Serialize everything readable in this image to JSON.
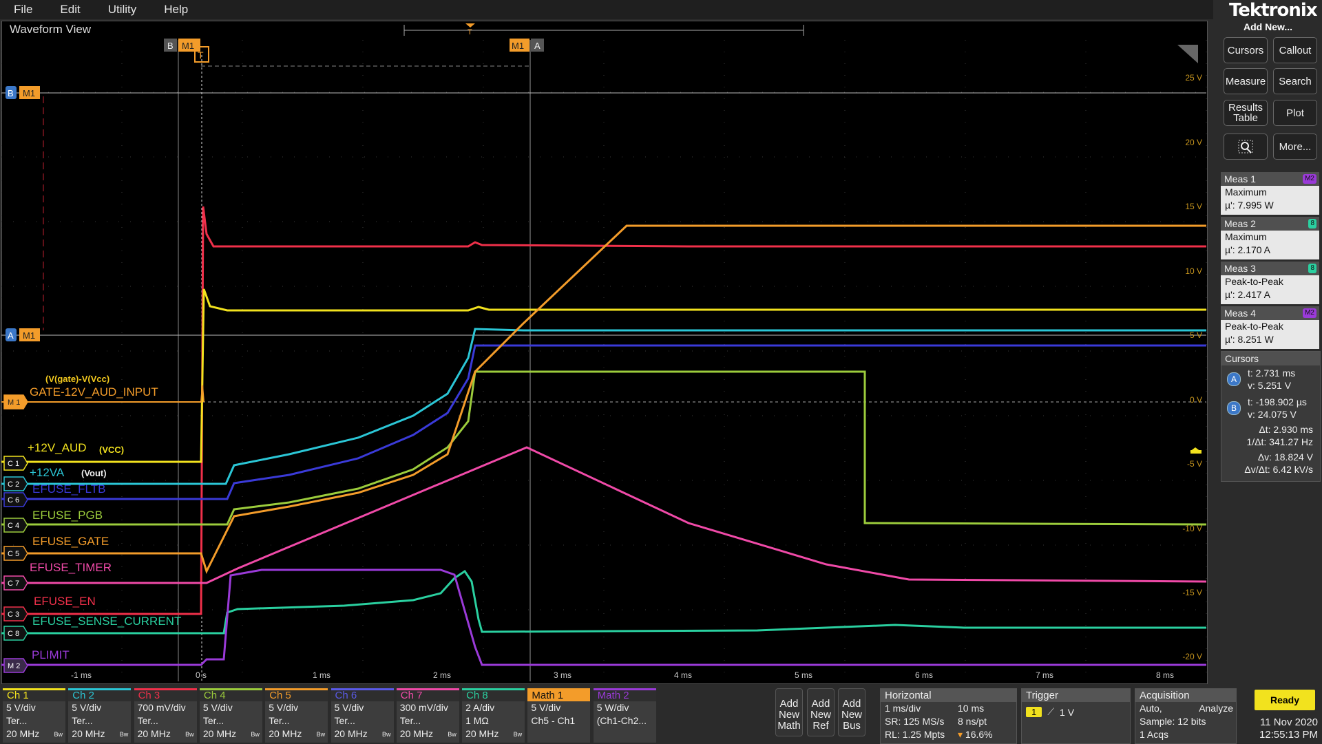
{
  "menu": [
    "File",
    "Edit",
    "Utility",
    "Help"
  ],
  "waveform_view": {
    "title": "Waveform View",
    "marker_b": "B",
    "marker_a": "A",
    "m1_tag": "M1",
    "y_ticks": [
      "25 V",
      "20 V",
      "15 V",
      "10 V",
      "5 V",
      "0 V",
      "-5 V",
      "-10 V",
      "-15 V",
      "-20 V"
    ],
    "x_ticks": [
      "-1 ms",
      "0 s",
      "1 ms",
      "2 ms",
      "3 ms",
      "4 ms",
      "5 ms",
      "6 ms",
      "7 ms",
      "8 ms"
    ],
    "annotations": {
      "gate_formula": "(V(gate)-V(Vcc)",
      "vcc": "(VCC)",
      "vout": "(Vout)"
    },
    "channel_labels": [
      {
        "tag": "M 1",
        "label": "GATE-12V_AUD_INPUT",
        "color": "#f39c2a"
      },
      {
        "tag": "C 1",
        "label": "+12V_AUD",
        "color": "#f2e21e"
      },
      {
        "tag": "C 2",
        "label": "+12VA",
        "color": "#2bc6d6"
      },
      {
        "tag": "C 6",
        "label": "EFUSE_FLTB",
        "color": "#3a3ad8"
      },
      {
        "tag": "C 4",
        "label": "EFUSE_PGB",
        "color": "#9ccc3c"
      },
      {
        "tag": "C 5",
        "label": "EFUSE_GATE",
        "color": "#f39c2a"
      },
      {
        "tag": "C 7",
        "label": "EFUSE_TIMER",
        "color": "#f04aa8"
      },
      {
        "tag": "C 3",
        "label": "EFUSE_EN",
        "color": "#f0304a"
      },
      {
        "tag": "C 8",
        "label": "EFUSE_SENSE_CURRENT",
        "color": "#2ad0a0"
      },
      {
        "tag": "M 2",
        "label": "PLIMIT",
        "color": "#9a3ad8"
      }
    ]
  },
  "right_panel": {
    "logo": "Tektronix",
    "add_new": "Add New...",
    "buttons": [
      "Cursors",
      "Callout",
      "Measure",
      "Search",
      "Results Table",
      "Plot",
      "More..."
    ],
    "measurements": [
      {
        "name": "Meas 1",
        "badge": "M2",
        "badge_color": "#9a3ad8",
        "type": "Maximum",
        "value": "µ': 7.995 W"
      },
      {
        "name": "Meas 2",
        "badge": "8",
        "badge_color": "#2ad0a0",
        "type": "Maximum",
        "value": "µ': 2.170 A"
      },
      {
        "name": "Meas 3",
        "badge": "8",
        "badge_color": "#2ad0a0",
        "type": "Peak-to-Peak",
        "value": "µ': 2.417 A"
      },
      {
        "name": "Meas 4",
        "badge": "M2",
        "badge_color": "#9a3ad8",
        "type": "Peak-to-Peak",
        "value": "µ': 8.251 W"
      }
    ],
    "cursors": {
      "title": "Cursors",
      "a_t": "t: 2.731 ms",
      "a_v": "v: 5.251 V",
      "b_t": "t: -198.902 µs",
      "b_v": "v: 24.075 V",
      "dt": "Δt: 2.930 ms",
      "inv_dt": "1/Δt: 341.27 Hz",
      "dv": "Δv: 18.824 V",
      "dvdt": "Δv/Δt: 6.42 kV/s"
    }
  },
  "channels": [
    {
      "name": "Ch 1",
      "l1": "5 V/div",
      "l2": "Ter...",
      "l3": "20 MHz",
      "color": "#f2e21e",
      "bw": true
    },
    {
      "name": "Ch 2",
      "l1": "5 V/div",
      "l2": "Ter...",
      "l3": "20 MHz",
      "color": "#2bc6d6",
      "bw": true
    },
    {
      "name": "Ch 3",
      "l1": "700 mV/div",
      "l2": "Ter...",
      "l3": "20 MHz",
      "color": "#f0304a",
      "bw": true
    },
    {
      "name": "Ch 4",
      "l1": "5 V/div",
      "l2": "Ter...",
      "l3": "20 MHz",
      "color": "#9ccc3c",
      "bw": true
    },
    {
      "name": "Ch 5",
      "l1": "5 V/div",
      "l2": "Ter...",
      "l3": "20 MHz",
      "color": "#f39c2a",
      "bw": true
    },
    {
      "name": "Ch 6",
      "l1": "5 V/div",
      "l2": "Ter...",
      "l3": "20 MHz",
      "color": "#5a5ae8",
      "bw": true
    },
    {
      "name": "Ch 7",
      "l1": "300 mV/div",
      "l2": "Ter...",
      "l3": "20 MHz",
      "color": "#f04aa8",
      "bw": true
    },
    {
      "name": "Ch 8",
      "l1": "2 A/div",
      "l2": "1 MΩ",
      "l3": "20 MHz",
      "color": "#2ad0a0",
      "bw": true
    },
    {
      "name": "Math 1",
      "l1": "5 V/div",
      "l2": "Ch5 - Ch1",
      "l3": "",
      "color": "#f39c2a",
      "bw": false
    },
    {
      "name": "Math 2",
      "l1": "5 W/div",
      "l2": "(Ch1-Ch2...",
      "l3": "",
      "color": "#9a3ad8",
      "bw": false
    }
  ],
  "bw_tag": "Bw",
  "add_buttons": [
    {
      "l1": "Add",
      "l2": "New",
      "l3": "Math"
    },
    {
      "l1": "Add",
      "l2": "New",
      "l3": "Ref"
    },
    {
      "l1": "Add",
      "l2": "New",
      "l3": "Bus"
    }
  ],
  "horizontal": {
    "title": "Horizontal",
    "scale": "1 ms/div",
    "record_time": "10 ms",
    "sr": "SR: 125 MS/s",
    "spacing": "8 ns/pt",
    "rl": "RL: 1.25 Mpts",
    "position": "16.6%"
  },
  "trigger": {
    "title": "Trigger",
    "source": "1",
    "level": "1 V"
  },
  "acquisition": {
    "title": "Acquisition",
    "mode": "Auto,",
    "action": "Analyze",
    "sample": "Sample: 12 bits",
    "acqs": "1 Acqs"
  },
  "status": {
    "ready": "Ready",
    "date": "11 Nov 2020",
    "time": "12:55:13 PM"
  }
}
